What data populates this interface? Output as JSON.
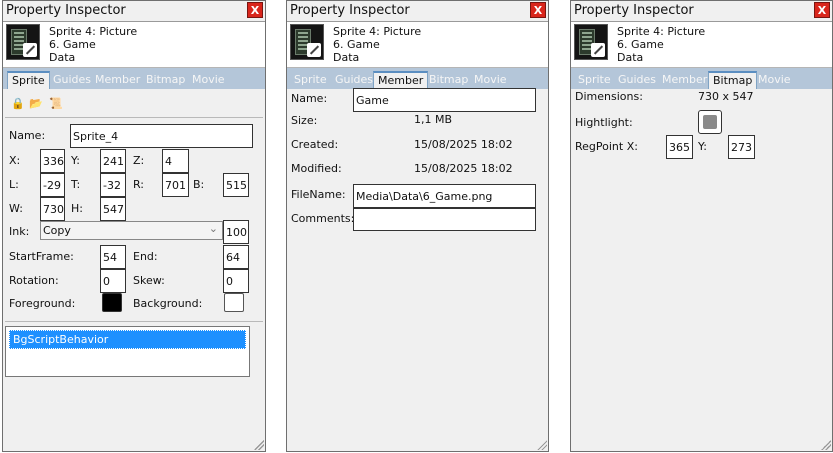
{
  "window_title": "Property Inspector",
  "close_label": "X",
  "header": {
    "line1": "Sprite 4: Picture",
    "line2": "6. Game",
    "line3": "Data"
  },
  "tabs": [
    "Sprite",
    "Guides",
    "Member",
    "Bitmap",
    "Movie"
  ],
  "sprite": {
    "name_label": "Name:",
    "name_value": "Sprite_4",
    "x_label": "X:",
    "x": "336",
    "y_label": "Y:",
    "y": "241",
    "z_label": "Z:",
    "z": "4",
    "l_label": "L:",
    "l": "-29",
    "t_label": "T:",
    "t": "-32",
    "r_label": "R:",
    "r": "701",
    "b_label": "B:",
    "b": "515",
    "w_label": "W:",
    "w": "730",
    "h_label": "H:",
    "h": "547",
    "ink_label": "Ink:",
    "ink": "Copy",
    "blend": "100",
    "startframe_label": "StartFrame:",
    "startframe": "54",
    "end_label": "End:",
    "end": "64",
    "rotation_label": "Rotation:",
    "rotation": "0",
    "skew_label": "Skew:",
    "skew": "0",
    "foreground_label": "Foreground:",
    "foreground_color": "#000000",
    "background_label": "Background:",
    "background_color": "#ffffff",
    "behaviors": [
      "BgScriptBehavior"
    ]
  },
  "member": {
    "name_label": "Name:",
    "name_value": "Game",
    "size_label": "Size:",
    "size": "1,1 MB",
    "created_label": "Created:",
    "created": "15/08/2025 18:02",
    "modified_label": "Modified:",
    "modified": "15/08/2025 18:02",
    "filename_label": "FileName:",
    "filename": "Media\\Data\\6_Game.png",
    "comments_label": "Comments:",
    "comments": ""
  },
  "bitmap": {
    "dimensions_label": "Dimensions:",
    "dimensions": "730 x 547",
    "highlight_label": "Hightlight:",
    "regpoint_label": "RegPoint X:",
    "regx": "365",
    "regy_label": "Y:",
    "regy": "273"
  },
  "colors": {
    "tabbar": "#b4c6d9",
    "selection": "#1e90ff",
    "close": "#d9261c"
  }
}
